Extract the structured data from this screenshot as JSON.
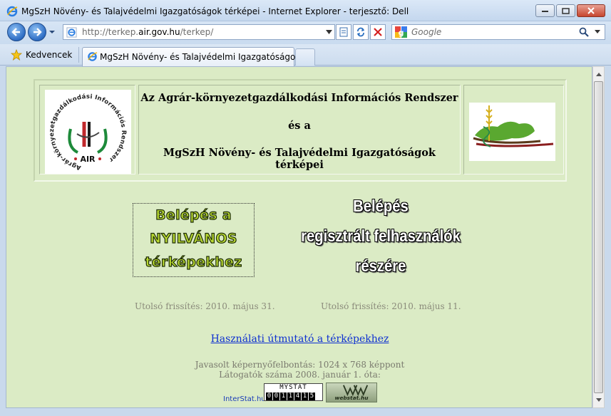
{
  "window": {
    "title": "MgSzH Növény- és Talajvédelmi Igazgatóságok térképei - Internet Explorer - terjesztő: Dell"
  },
  "toolbar": {
    "url_prefix": "http://terkep.",
    "url_domain": "air.gov.hu",
    "url_suffix": "/terkep/",
    "search_placeholder": "Google"
  },
  "favorites_label": "Kedvencek",
  "tab": {
    "title": "MgSzH Növény- és Talajvédelmi Igazgatóságok t..."
  },
  "header": {
    "line1": "Az Agrár-környezetgazdálkodási Információs Rendszer",
    "line2": "és a",
    "line3": "MgSzH Növény- és Talajvédelmi Igazgatóságok térképei",
    "logo_text": "AIR",
    "logo_ring_text": "Agrár-környezetgazdálkodási Információs Rendszer"
  },
  "public_button": {
    "line1": "Belépés a",
    "line2": "NYILVÁNOS",
    "line3": "térképekhez"
  },
  "registered_button": {
    "line1": "Belépés",
    "line2": "regisztrált felhasználók",
    "line3": "részére"
  },
  "updates": {
    "public": "Utolsó frissítés: 2010. május 31.",
    "registered": "Utolsó frissítés: 2010. május 11."
  },
  "guide_link": "Használati útmutató a térképekhez",
  "footer": {
    "resolution": "Javasolt képernyőfelbontás: 1024 x 768 képpont",
    "visitors": "Látogatók száma 2008. január 1. óta:",
    "interstat": "InterStat.hu",
    "mystat_title": "MYSTAT",
    "mystat_digits": [
      "0",
      "0",
      "1",
      "1",
      "4",
      "1",
      "5"
    ],
    "webstat": "webstat.hu"
  },
  "colors": {
    "page_background": "#dbebc5",
    "link": "#0d2fd1",
    "public_button_fill": "#b8d832"
  }
}
